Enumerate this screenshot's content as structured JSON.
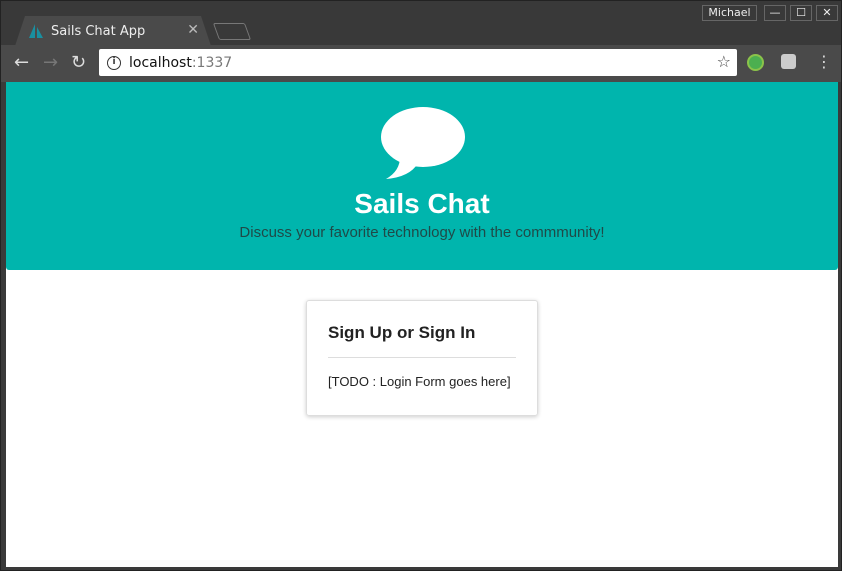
{
  "browser": {
    "tab_title": "Sails Chat App",
    "user": "Michael",
    "url_host": "localhost",
    "url_port": ":1337"
  },
  "hero": {
    "title": "Sails Chat",
    "subtitle": "Discuss your favorite technology with the commmunity!",
    "color": "#00b5ad"
  },
  "card": {
    "title": "Sign Up or Sign In",
    "body": "[TODO : Login Form goes here]"
  }
}
